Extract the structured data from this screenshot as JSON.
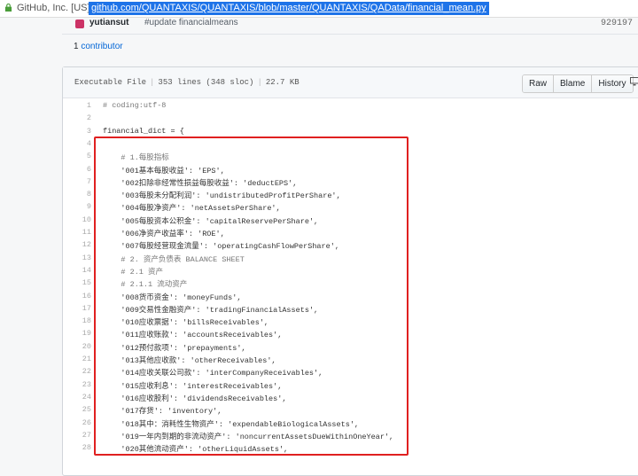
{
  "address_bar": {
    "site": "GitHub, Inc. [US]",
    "url": "github.com/QUANTAXIS/QUANTAXIS/blob/master/QUANTAXIS/QAData/financial_mean.py"
  },
  "commit": {
    "author": "yutiansut",
    "message": "#update financialmeans",
    "sha": "929197"
  },
  "contributors": {
    "count": "1",
    "label": "contributor"
  },
  "file_header": {
    "mode": "Executable File",
    "lines": "353 lines (348 sloc)",
    "size": "22.7 KB",
    "buttons": [
      "Raw",
      "Blame",
      "History"
    ]
  },
  "code_lines": [
    {
      "n": "1",
      "t": "# coding:utf-8"
    },
    {
      "n": "2",
      "t": ""
    },
    {
      "n": "3",
      "t": "financial_dict = {"
    },
    {
      "n": "4",
      "t": ""
    },
    {
      "n": "5",
      "t": "    # 1.每股指标"
    },
    {
      "n": "6",
      "t": "    '001基本每股收益': 'EPS',"
    },
    {
      "n": "7",
      "t": "    '002扣除非经常性损益每股收益': 'deductEPS',"
    },
    {
      "n": "8",
      "t": "    '003每股未分配利润': 'undistributedProfitPerShare',"
    },
    {
      "n": "9",
      "t": "    '004每股净资产': 'netAssetsPerShare',"
    },
    {
      "n": "10",
      "t": "    '005每股资本公积金': 'capitalReservePerShare',"
    },
    {
      "n": "11",
      "t": "    '006净资产收益率': 'ROE',"
    },
    {
      "n": "12",
      "t": "    '007每股经营现金流量': 'operatingCashFlowPerShare',"
    },
    {
      "n": "13",
      "t": "    # 2. 资产负债表 BALANCE SHEET"
    },
    {
      "n": "14",
      "t": "    # 2.1 资产"
    },
    {
      "n": "15",
      "t": "    # 2.1.1 流动资产"
    },
    {
      "n": "16",
      "t": "    '008货币资金': 'moneyFunds',"
    },
    {
      "n": "17",
      "t": "    '009交易性金融资产': 'tradingFinancialAssets',"
    },
    {
      "n": "18",
      "t": "    '010应收票据': 'billsReceivables',"
    },
    {
      "n": "19",
      "t": "    '011应收账款': 'accountsReceivables',"
    },
    {
      "n": "20",
      "t": "    '012预付款项': 'prepayments',"
    },
    {
      "n": "21",
      "t": "    '013其他应收款': 'otherReceivables',"
    },
    {
      "n": "22",
      "t": "    '014应收关联公司款': 'interCompanyReceivables',"
    },
    {
      "n": "23",
      "t": "    '015应收利息': 'interestReceivables',"
    },
    {
      "n": "24",
      "t": "    '016应收股利': 'dividendsReceivables',"
    },
    {
      "n": "25",
      "t": "    '017存货': 'inventory',"
    },
    {
      "n": "26",
      "t": "    '018其中：消耗性生物资产': 'expendableBiologicalAssets',"
    },
    {
      "n": "27",
      "t": "    '019一年内到期的非流动资产': 'noncurrentAssetsDueWithinOneYear',"
    },
    {
      "n": "28",
      "t": "    '020其他流动资产': 'otherLiquidAssets',"
    }
  ],
  "colors": {
    "highlight": "#e02020",
    "url_selection": "#1e73e8",
    "link": "#0366d6"
  }
}
